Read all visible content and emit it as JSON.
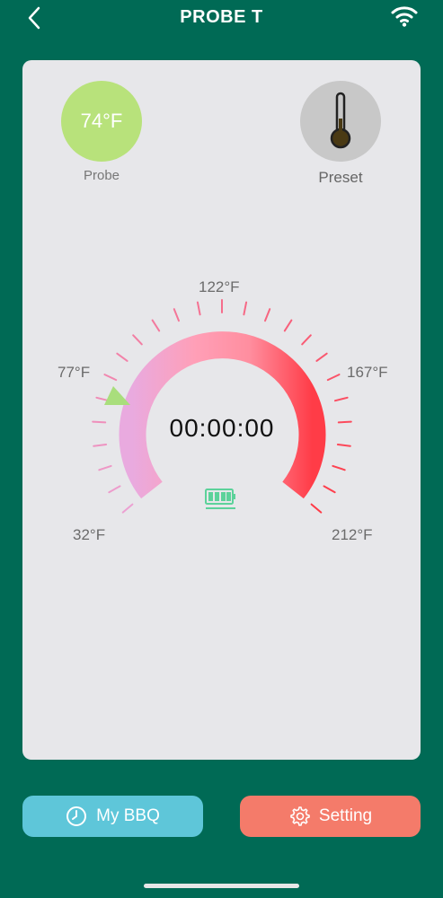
{
  "header": {
    "title": "PROBE T"
  },
  "probe": {
    "temp": "74°F",
    "label": "Probe"
  },
  "preset": {
    "label": "Preset"
  },
  "gauge": {
    "labels": {
      "top": "122°F",
      "upper_left": "77°F",
      "upper_right": "167°F",
      "lower_left": "32°F",
      "lower_right": "212°F"
    },
    "timer": "00:00:00"
  },
  "buttons": {
    "bbq": "My BBQ",
    "setting": "Setting"
  },
  "colors": {
    "background": "#006a55",
    "probe": "#b8e27b",
    "bbq": "#5ec6d9",
    "setting": "#f47b6a"
  },
  "icons": {
    "back": "chevron-left-icon",
    "wifi": "wifi-icon",
    "thermometer": "thermometer-icon",
    "battery": "battery-icon",
    "clock": "clock-icon",
    "gear": "gear-icon"
  }
}
